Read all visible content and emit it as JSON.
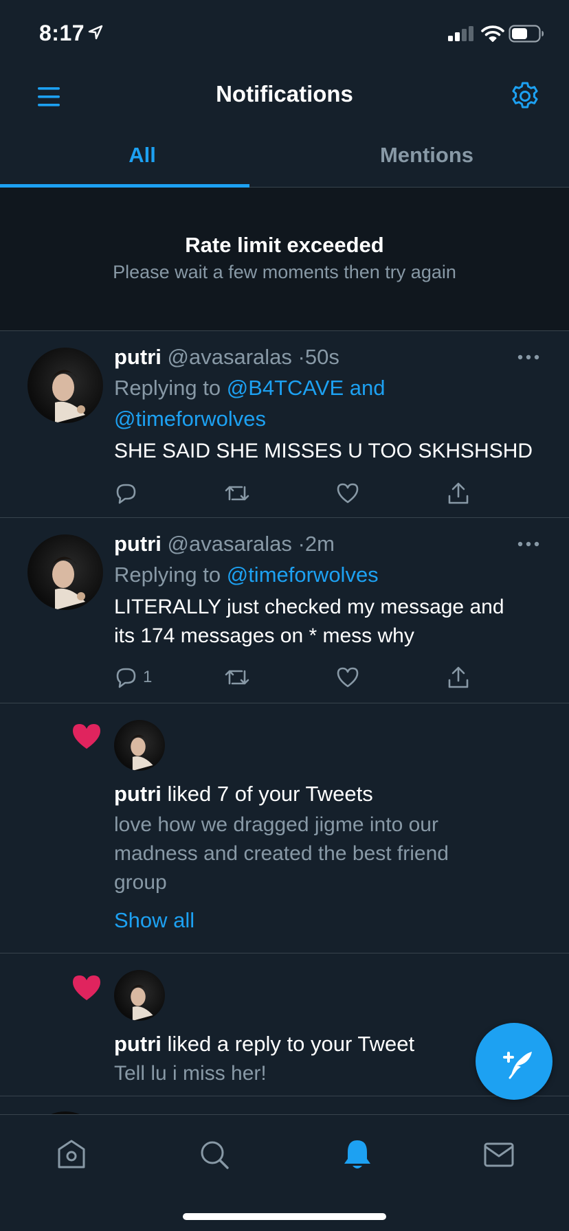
{
  "status_bar": {
    "time": "8:17"
  },
  "header": {
    "title": "Notifications"
  },
  "tabs": [
    {
      "label": "All"
    },
    {
      "label": "Mentions"
    }
  ],
  "rate_limit": {
    "title": "Rate limit exceeded",
    "message": "Please wait a few moments then try again"
  },
  "tweets": [
    {
      "name": "putri",
      "handle": "@avasaralas",
      "separator": "·",
      "time": "50s",
      "replying_prefix": "Replying to",
      "replying_line1": "@B4TCAVE and",
      "replying_line2": "@timeforwolves",
      "text": "SHE SAID SHE MISSES U TOO SKHSHSHD",
      "reply_count": ""
    },
    {
      "name": "putri",
      "handle": "@avasaralas",
      "separator": "·",
      "time": "2m",
      "replying_prefix": "Replying to",
      "replying_line1": "@timeforwolves",
      "text_line1": "LITERALLY just checked my message and",
      "text_line2": "its 174 messages on * mess why",
      "reply_count": "1"
    }
  ],
  "likes": [
    {
      "name": "putri",
      "action": "liked 7 of your Tweets",
      "excerpt_line1": "love how we dragged jigme into our",
      "excerpt_line2": "madness and created the best friend",
      "excerpt_line3": "group",
      "show_all": "Show all"
    },
    {
      "name": "putri",
      "action": "liked a reply to your Tweet",
      "excerpt_line1": "Tell lu i miss her!"
    }
  ],
  "colors": {
    "background": "#15202b",
    "accent": "#1da1f2",
    "secondary_text": "#8899a6",
    "like": "#e0245e",
    "divider": "#38444d"
  },
  "icons": {
    "header_left": "menu-icon",
    "header_right": "settings-gear-icon",
    "tweet_actions": [
      "reply-icon",
      "retweet-icon",
      "like-icon",
      "share-icon"
    ],
    "fab": "compose-tweet-icon",
    "nav": [
      "home-icon",
      "search-icon",
      "notifications-bell-icon",
      "messages-icon"
    ]
  }
}
